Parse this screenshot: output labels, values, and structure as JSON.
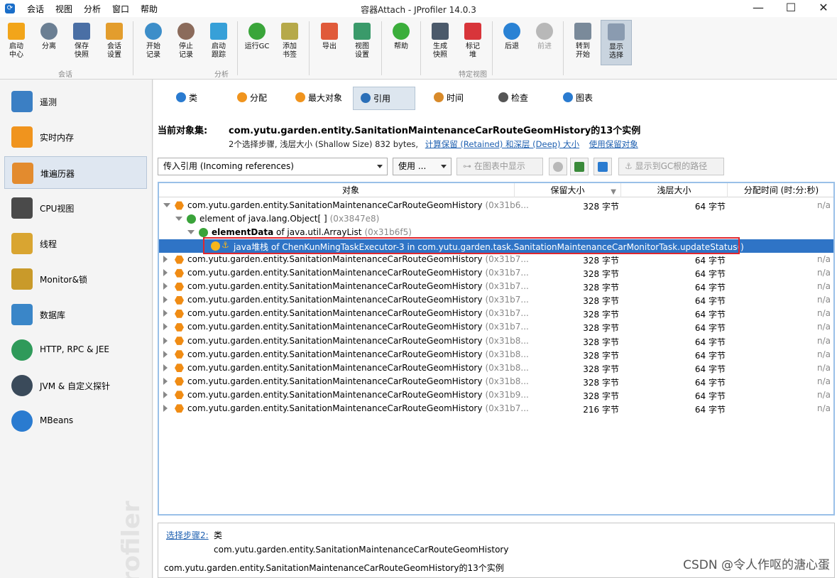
{
  "app": {
    "title": "容器Attach - JProfiler 14.0.3",
    "menu": [
      "会话",
      "视图",
      "分析",
      "窗口",
      "帮助"
    ]
  },
  "ribbon": {
    "buttons": [
      {
        "label1": "启动",
        "label2": "中心",
        "icon": "start-center-icon",
        "color": "#f2a51a"
      },
      {
        "label1": "分离",
        "label2": "",
        "icon": "detach-icon",
        "color": "#6b7f93"
      },
      {
        "label1": "保存",
        "label2": "快照",
        "icon": "save-snapshot-icon",
        "color": "#4a6fa5"
      },
      {
        "label1": "会话",
        "label2": "设置",
        "icon": "session-settings-icon",
        "color": "#e39d2d"
      },
      {
        "label1": "开始",
        "label2": "记录",
        "icon": "start-recording-icon",
        "color": "#3d8ec9"
      },
      {
        "label1": "停止",
        "label2": "记录",
        "icon": "stop-recording-icon",
        "color": "#8b6b5b"
      },
      {
        "label1": "启动",
        "label2": "跟踪",
        "icon": "start-tracking-icon",
        "color": "#37a0d8"
      },
      {
        "label1": "运行GC",
        "label2": "",
        "icon": "run-gc-icon",
        "color": "#3aa53a"
      },
      {
        "label1": "添加",
        "label2": "书签",
        "icon": "add-bookmark-icon",
        "color": "#b6a94a"
      },
      {
        "label1": "导出",
        "label2": "",
        "icon": "export-icon",
        "color": "#e05a3a"
      },
      {
        "label1": "视图",
        "label2": "设置",
        "icon": "view-settings-icon",
        "color": "#3a9a6a"
      },
      {
        "label1": "帮助",
        "label2": "",
        "icon": "help-icon",
        "color": "#3bae3b"
      },
      {
        "label1": "生成",
        "label2": "快照",
        "icon": "camera-icon",
        "color": "#4b5a6b"
      },
      {
        "label1": "标记",
        "label2": "堆",
        "icon": "pin-icon",
        "color": "#d8353a"
      },
      {
        "label1": "后退",
        "label2": "",
        "icon": "back-icon",
        "color": "#2a82d4"
      },
      {
        "label1": "前进",
        "label2": "",
        "icon": "forward-icon",
        "color": "#b8b8b8"
      },
      {
        "label1": "转到",
        "label2": "开始",
        "icon": "home-icon",
        "color": "#7a8a9a"
      },
      {
        "label1": "显示",
        "label2": "选择",
        "icon": "show-selection-icon",
        "color": "#8a9bb0"
      }
    ],
    "groups": [
      "会话",
      "分析",
      "特定视图"
    ]
  },
  "sidebar": {
    "items": [
      {
        "label": "遥测",
        "icon": "telemetry-icon",
        "color": "#3b7fc4"
      },
      {
        "label": "实时内存",
        "icon": "live-memory-icon",
        "color": "#f0941e"
      },
      {
        "label": "堆遍历器",
        "icon": "heap-walker-icon",
        "color": "#e38b2e"
      },
      {
        "label": "CPU视图",
        "icon": "cpu-icon",
        "color": "#4a4a4a"
      },
      {
        "label": "线程",
        "icon": "threads-icon",
        "color": "#d9a531"
      },
      {
        "label": "Monitor&锁",
        "icon": "lock-icon",
        "color": "#c99a2a"
      },
      {
        "label": "数据库",
        "icon": "database-icon",
        "color": "#3a86c8"
      },
      {
        "label": "HTTP, RPC & JEE",
        "icon": "globe-icon",
        "color": "#2f9a5a"
      },
      {
        "label": "JVM & 自定义探针",
        "icon": "gauge-icon",
        "color": "#3a4a5a"
      },
      {
        "label": "MBeans",
        "icon": "mbeans-globe-icon",
        "color": "#2a7bd0"
      }
    ],
    "watermark": "rofiler"
  },
  "tabs": [
    {
      "label": "类",
      "icon": "class-icon",
      "color": "#2a7bd0"
    },
    {
      "label": "分配",
      "icon": "allocation-icon",
      "color": "#f0941e"
    },
    {
      "label": "最大对象",
      "icon": "biggest-objects-icon",
      "color": "#f0941e"
    },
    {
      "label": "引用",
      "icon": "references-icon",
      "color": "#2a6fb8"
    },
    {
      "label": "时间",
      "icon": "clock-icon",
      "color": "#d88a2a"
    },
    {
      "label": "检查",
      "icon": "inspect-gear-icon",
      "color": "#555555"
    },
    {
      "label": "图表",
      "icon": "graph-icon",
      "color": "#2a7bd0"
    }
  ],
  "header": {
    "current_label": "当前对象集:",
    "current_name": "com.yutu.garden.entity.SanitationMaintenanceCarRouteGeomHistory的13个实例",
    "sub_text": "2个选择步骤, 浅层大小 (Shallow Size) 832 bytes,",
    "link1": "计算保留 (Retained) 和深层 (Deep) 大小",
    "link2": "使用保留对象"
  },
  "controls": {
    "refs_combo": "传入引用 (Incoming references)",
    "use_button": "使用 ...",
    "show_in_graph": "在图表中显示",
    "show_gc_path": "显示到GC根的路径"
  },
  "table": {
    "columns": [
      "对象",
      "保留大小",
      "浅层大小",
      "分配时间 (时:分:秒)"
    ],
    "rows": [
      {
        "level": 0,
        "open": true,
        "icon": "hex",
        "bold": "",
        "name": "com.yutu.garden.entity.SanitationMaintenanceCarRouteGeomHistory",
        "addr": "(0x31b6...",
        "retained": "328 字节",
        "shallow": "64 字节",
        "time": "n/a"
      },
      {
        "level": 1,
        "open": true,
        "icon": "grn",
        "bold": "",
        "name": "element of java.lang.Object[ ]",
        "addr": "(0x3847e8)",
        "retained": "",
        "shallow": "",
        "time": ""
      },
      {
        "level": 2,
        "open": true,
        "icon": "grn",
        "bold": "elementData",
        "name": " of java.util.ArrayList",
        "addr": "(0x31b6f5)",
        "retained": "",
        "shallow": "",
        "time": ""
      },
      {
        "level": 3,
        "open": null,
        "icon": "yel",
        "bold": "",
        "name": "java堆栈 of ChenKunMingTaskExecutor-3 in com.yutu.garden.task.SanitationMaintenanceCarMonitorTask.updateStatus()",
        "addr": "",
        "retained": "",
        "shallow": "",
        "time": "",
        "selected": true
      },
      {
        "level": 0,
        "open": false,
        "icon": "hex",
        "bold": "",
        "name": "com.yutu.garden.entity.SanitationMaintenanceCarRouteGeomHistory",
        "addr": "(0x31b7...",
        "retained": "328 字节",
        "shallow": "64 字节",
        "time": "n/a"
      },
      {
        "level": 0,
        "open": false,
        "icon": "hex",
        "bold": "",
        "name": "com.yutu.garden.entity.SanitationMaintenanceCarRouteGeomHistory",
        "addr": "(0x31b7...",
        "retained": "328 字节",
        "shallow": "64 字节",
        "time": "n/a"
      },
      {
        "level": 0,
        "open": false,
        "icon": "hex",
        "bold": "",
        "name": "com.yutu.garden.entity.SanitationMaintenanceCarRouteGeomHistory",
        "addr": "(0x31b7...",
        "retained": "328 字节",
        "shallow": "64 字节",
        "time": "n/a"
      },
      {
        "level": 0,
        "open": false,
        "icon": "hex",
        "bold": "",
        "name": "com.yutu.garden.entity.SanitationMaintenanceCarRouteGeomHistory",
        "addr": "(0x31b7...",
        "retained": "328 字节",
        "shallow": "64 字节",
        "time": "n/a"
      },
      {
        "level": 0,
        "open": false,
        "icon": "hex",
        "bold": "",
        "name": "com.yutu.garden.entity.SanitationMaintenanceCarRouteGeomHistory",
        "addr": "(0x31b7...",
        "retained": "328 字节",
        "shallow": "64 字节",
        "time": "n/a"
      },
      {
        "level": 0,
        "open": false,
        "icon": "hex",
        "bold": "",
        "name": "com.yutu.garden.entity.SanitationMaintenanceCarRouteGeomHistory",
        "addr": "(0x31b7...",
        "retained": "328 字节",
        "shallow": "64 字节",
        "time": "n/a"
      },
      {
        "level": 0,
        "open": false,
        "icon": "hex",
        "bold": "",
        "name": "com.yutu.garden.entity.SanitationMaintenanceCarRouteGeomHistory",
        "addr": "(0x31b8...",
        "retained": "328 字节",
        "shallow": "64 字节",
        "time": "n/a"
      },
      {
        "level": 0,
        "open": false,
        "icon": "hex",
        "bold": "",
        "name": "com.yutu.garden.entity.SanitationMaintenanceCarRouteGeomHistory",
        "addr": "(0x31b8...",
        "retained": "328 字节",
        "shallow": "64 字节",
        "time": "n/a"
      },
      {
        "level": 0,
        "open": false,
        "icon": "hex",
        "bold": "",
        "name": "com.yutu.garden.entity.SanitationMaintenanceCarRouteGeomHistory",
        "addr": "(0x31b8...",
        "retained": "328 字节",
        "shallow": "64 字节",
        "time": "n/a"
      },
      {
        "level": 0,
        "open": false,
        "icon": "hex",
        "bold": "",
        "name": "com.yutu.garden.entity.SanitationMaintenanceCarRouteGeomHistory",
        "addr": "(0x31b8...",
        "retained": "328 字节",
        "shallow": "64 字节",
        "time": "n/a"
      },
      {
        "level": 0,
        "open": false,
        "icon": "hex",
        "bold": "",
        "name": "com.yutu.garden.entity.SanitationMaintenanceCarRouteGeomHistory",
        "addr": "(0x31b9...",
        "retained": "328 字节",
        "shallow": "64 字节",
        "time": "n/a"
      },
      {
        "level": 0,
        "open": false,
        "icon": "hex",
        "bold": "",
        "name": "com.yutu.garden.entity.SanitationMaintenanceCarRouteGeomHistory",
        "addr": "(0x31b7...",
        "retained": "216 字节",
        "shallow": "64 字节",
        "time": "n/a"
      }
    ]
  },
  "bottom": {
    "step_link": "选择步骤2:",
    "step_kind": "类",
    "step_class": "com.yutu.garden.entity.SanitationMaintenanceCarRouteGeomHistory",
    "summary": "com.yutu.garden.entity.SanitationMaintenanceCarRouteGeomHistory的13个实例"
  },
  "watermark_text": "CSDN @令人作呕的溏心蛋"
}
